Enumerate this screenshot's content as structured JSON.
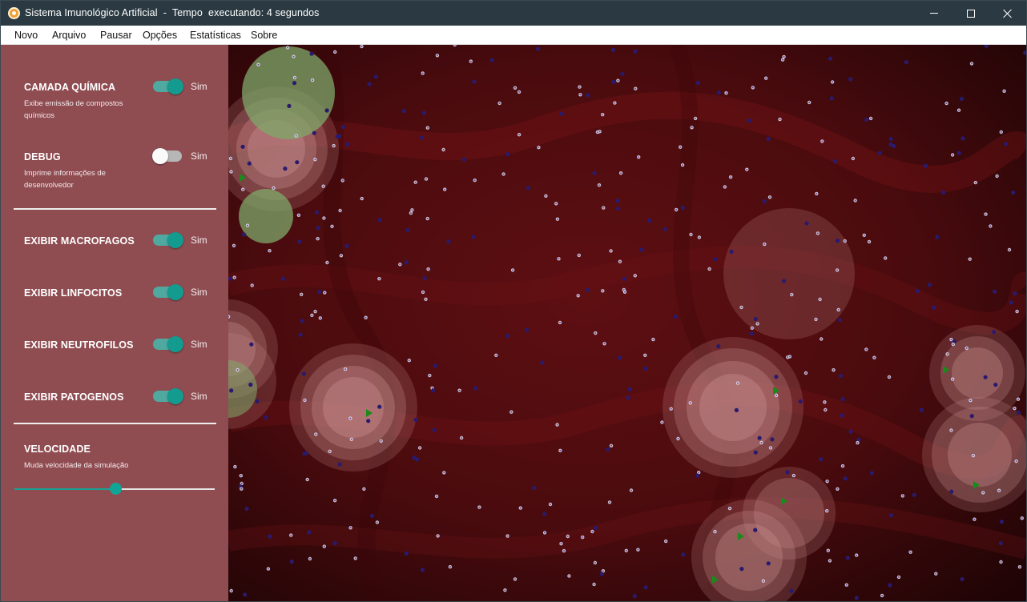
{
  "window": {
    "title": "Sistema Imunológico Artificial  -  Tempo  executando: 4 segundos"
  },
  "menu": [
    "Novo",
    "Arquivo",
    "Pausar",
    "Opções",
    "Estatísticas",
    "Sobre"
  ],
  "sidebar": {
    "chemical": {
      "title": "CAMADA QUÍMICA",
      "description": "Exibe emissão de compostos químicos",
      "toggle_label": "Sim",
      "on": true
    },
    "debug": {
      "title": "DEBUG",
      "description": "Imprime informações de desenvolvedor",
      "toggle_label": "Sim",
      "on": false
    },
    "macrophages": {
      "title": "EXIBIR MACROFAGOS",
      "toggle_label": "Sim",
      "on": true
    },
    "lymphocytes": {
      "title": "EXIBIR LINFOCITOS",
      "toggle_label": "Sim",
      "on": true
    },
    "neutrophils": {
      "title": "EXIBIR NEUTROFILOS",
      "toggle_label": "Sim",
      "on": true
    },
    "pathogens": {
      "title": "EXIBIR PATOGENOS",
      "toggle_label": "Sim",
      "on": true
    },
    "speed": {
      "title": "VELOCIDADE",
      "description": "Muda velocidade da simulação",
      "value": 0.5
    }
  },
  "colors": {
    "titlebar": "#2b3a42",
    "sidebar": "#8f4d52",
    "toggle_accent": "#139b8f",
    "tissue": "#5a0d10",
    "chemical_zone": "#c98f8f",
    "green_zone": "#7fa86a",
    "pathogen_marker": "#1a8a1a"
  }
}
